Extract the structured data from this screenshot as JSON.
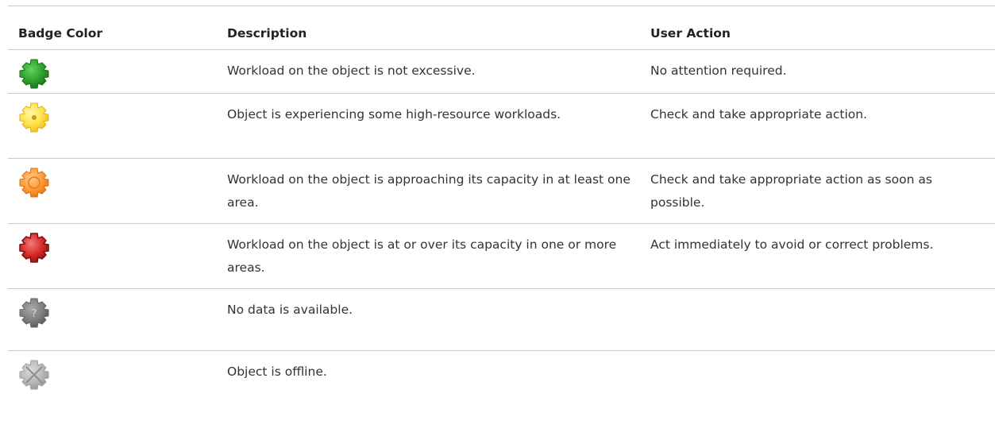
{
  "table": {
    "headers": {
      "badge_color": "Badge Color",
      "description": "Description",
      "user_action": "User Action"
    },
    "rows": [
      {
        "badge": "green-gear-badge-icon",
        "badge_color_hex": "#2ea32e",
        "description": "Workload on the object is not excessive.",
        "user_action": "No attention required."
      },
      {
        "badge": "yellow-gear-badge-icon",
        "badge_color_hex": "#ffe34d",
        "description": "Object is experiencing some high-resource workloads.",
        "user_action": "Check and take appropriate action."
      },
      {
        "badge": "orange-gear-badge-icon",
        "badge_color_hex": "#ff9d3a",
        "description": "Workload on the object is approaching its capacity in at least one area.",
        "user_action": "Check and take appropriate action as soon as possible."
      },
      {
        "badge": "red-gear-badge-icon",
        "badge_color_hex": "#d92b2b",
        "description": "Workload on the object is at or over its capacity in one or more areas.",
        "user_action": "Act immediately to avoid or correct problems."
      },
      {
        "badge": "gray-question-gear-badge-icon",
        "badge_color_hex": "#808080",
        "badge_glyph": "?",
        "description": "No data is available.",
        "user_action": ""
      },
      {
        "badge": "light-gray-x-gear-badge-icon",
        "badge_color_hex": "#bbbbbb",
        "description": "Object is offline.",
        "user_action": ""
      }
    ]
  }
}
